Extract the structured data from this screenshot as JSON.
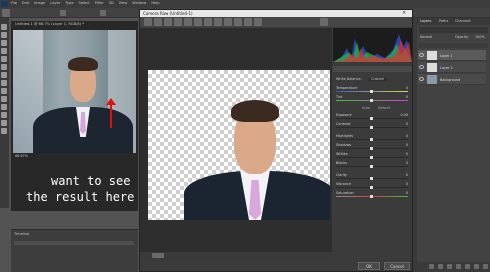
{
  "menubar": {
    "items": [
      "File",
      "Edit",
      "Image",
      "Layer",
      "Type",
      "Select",
      "Filter",
      "3D",
      "View",
      "Window",
      "Help"
    ]
  },
  "document": {
    "tab_title": "Untitled-1 @ 66.7% (Layer 1, RGB/8) *",
    "zoom": "66.67%",
    "timeline_label": "Timeline"
  },
  "annotation": {
    "line1": "want to see",
    "line2": "the result here"
  },
  "camera_raw": {
    "title": "Camera Raw (Untitled-1)",
    "white_balance_label": "White Balance:",
    "white_balance_value": "Custom",
    "tabs": [
      "Auto",
      "Default"
    ],
    "sliders": [
      {
        "label": "Temperature",
        "value": "0"
      },
      {
        "label": "Tint",
        "value": "0"
      },
      {
        "label": "Exposure",
        "value": "0.00"
      },
      {
        "label": "Contrast",
        "value": "0"
      },
      {
        "label": "Highlights",
        "value": "0"
      },
      {
        "label": "Shadows",
        "value": "0"
      },
      {
        "label": "Whites",
        "value": "0"
      },
      {
        "label": "Blacks",
        "value": "0"
      },
      {
        "label": "Clarity",
        "value": "0"
      },
      {
        "label": "Vibrance",
        "value": "0"
      },
      {
        "label": "Saturation",
        "value": "0"
      }
    ],
    "ok_label": "OK",
    "cancel_label": "Cancel"
  },
  "layers_panel": {
    "tabs": [
      "Layers",
      "Paths",
      "Channels"
    ],
    "blend_mode": "Normal",
    "opacity_label": "Opacity:",
    "opacity_value": "100%",
    "layers": [
      {
        "name": "Layer 1"
      },
      {
        "name": "Layer 2"
      },
      {
        "name": "Background"
      }
    ]
  },
  "colors": {
    "accent_arrow": "#e01010",
    "ok_button": "#4b4b4b"
  }
}
